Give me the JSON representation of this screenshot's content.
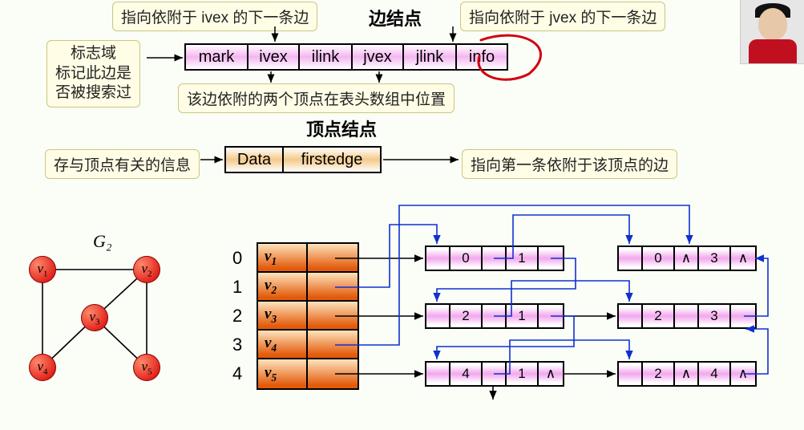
{
  "titles": {
    "edge_node": "边结点",
    "vertex_node": "顶点结点"
  },
  "top_callouts": {
    "ilink": "指向依附于 ivex 的下一条边",
    "jlink": "指向依附于 jvex 的下一条边",
    "mark": "标志域\n标记此边是\n否被搜索过",
    "ivex_jvex": "该边依附的两个顶点在表头数组中位置"
  },
  "edge_fields": [
    "mark",
    "ivex",
    "ilink",
    "jvex",
    "jlink",
    "info"
  ],
  "vertex_fields": [
    "Data",
    "firstedge"
  ],
  "vertex_callouts": {
    "data": "存与顶点有关的信息",
    "firstedge": "指向第一条依附于该顶点的边"
  },
  "graph": {
    "name": "G₂",
    "vertices": [
      "v₁",
      "v₂",
      "v₃",
      "v₄",
      "v₅"
    ],
    "edges": [
      [
        0,
        1
      ],
      [
        0,
        3
      ],
      [
        1,
        2
      ],
      [
        1,
        4
      ],
      [
        2,
        3
      ],
      [
        2,
        4
      ]
    ]
  },
  "vertex_array": {
    "indices": [
      "0",
      "1",
      "2",
      "3",
      "4"
    ],
    "labels": [
      "v₁",
      "v₂",
      "v₃",
      "v₄",
      "v₅"
    ]
  },
  "edge_nodes": {
    "r0a": [
      "",
      "0",
      "",
      "1",
      ""
    ],
    "r0b": [
      "",
      "0",
      "∧",
      "3",
      "∧"
    ],
    "r2a": [
      "",
      "2",
      "",
      "1",
      ""
    ],
    "r2b": [
      "",
      "2",
      "",
      "3",
      ""
    ],
    "r4a": [
      "",
      "4",
      "",
      "1",
      "∧"
    ],
    "r4b": [
      "",
      "2",
      "∧",
      "4",
      "∧"
    ]
  }
}
